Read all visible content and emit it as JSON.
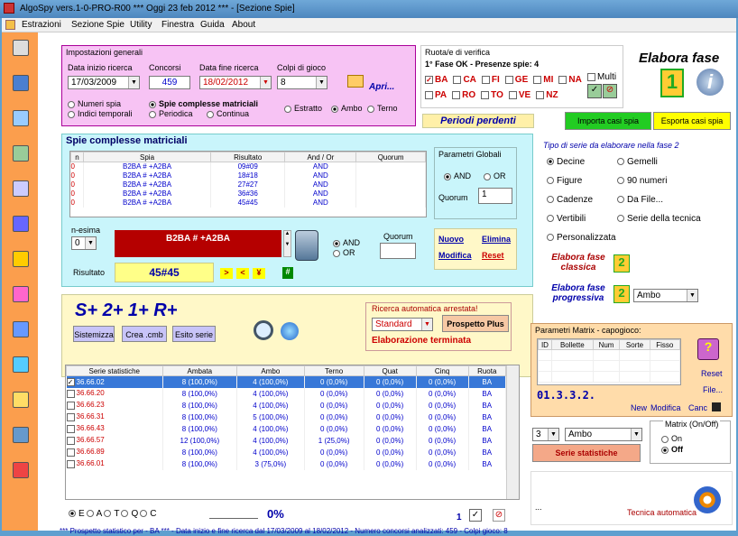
{
  "window": {
    "title": "AlgoSpy vers.1-0-PRO-R00  ***  Oggi 23 feb 2012  ***  - [Sezione Spie]"
  },
  "menu": [
    "Estrazioni",
    "Sezione Spie",
    "Utility",
    "Finestra",
    "Guida",
    "About"
  ],
  "general": {
    "title": "Impostazioni generali",
    "start_label": "Data inizio ricerca",
    "start": "17/03/2009",
    "concorsi_label": "Concorsi",
    "concorsi": "459",
    "end_label": "Data fine ricerca",
    "end": "18/02/2012",
    "colpi_label": "Colpi di gioco",
    "colpi": "8",
    "apri": "Apri...",
    "numeri_spia": "Numeri spia",
    "indici_temporali": "Indici temporali",
    "spie_complesse": "Spie complesse matriciali",
    "periodica": "Periodica",
    "continua": "Continua",
    "estratto": "Estratto",
    "ambo": "Ambo",
    "terno": "Terno"
  },
  "ruota": {
    "title": "Ruota/e di verifica",
    "status": "1° Fase OK - Presenze spie: 4",
    "row1": [
      "BA",
      "CA",
      "FI",
      "GE",
      "MI",
      "NA"
    ],
    "row2": [
      "PA",
      "RO",
      "TO",
      "VE",
      "NZ"
    ],
    "multi": "Multi"
  },
  "elabora": {
    "title": "Elabora fase",
    "digit": "1"
  },
  "periodi": "Periodi perdenti",
  "importa": "Importa casi spia",
  "esporta": "Esporta casi spia",
  "spie": {
    "title": "Spie complesse matriciali",
    "cols": [
      "n",
      "Spia",
      "Risultato",
      "And / Or",
      "Quorum"
    ],
    "rows": [
      [
        "0",
        "B2BA # +A2BA",
        "09#09",
        "AND",
        ""
      ],
      [
        "0",
        "B2BA # +A2BA",
        "18#18",
        "AND",
        ""
      ],
      [
        "0",
        "B2BA # +A2BA",
        "27#27",
        "AND",
        ""
      ],
      [
        "0",
        "B2BA # +A2BA",
        "36#36",
        "AND",
        ""
      ],
      [
        "0",
        "B2BA # +A2BA",
        "45#45",
        "AND",
        ""
      ]
    ],
    "nesima_label": "n-esima",
    "nesima": "0",
    "formula": "B2BA # +A2BA",
    "risultato_label": "Risultato",
    "risultato": "45#45",
    "and": "AND",
    "or": "OR",
    "quorum_label": "Quorum",
    "nuovo": "Nuovo",
    "elimina": "Elimina",
    "modifica": "Modifica",
    "reset": "Reset",
    "nav": [
      ">",
      "<",
      "¥"
    ],
    "hash": "#"
  },
  "globali": {
    "title": "Parametri Globali",
    "and": "AND",
    "or": "OR",
    "quorum_label": "Quorum",
    "quorum": "1"
  },
  "tipo": {
    "title": "Tipo di serie da elaborare nella fase 2",
    "left": [
      "Decine",
      "Figure",
      "Cadenze",
      "Vertibili",
      "Personalizzata"
    ],
    "right": [
      "Gemelli",
      "90 numeri",
      "Da File...",
      "Serie della tecnica"
    ],
    "classica": "Elabora fase classica",
    "progressiva": "Elabora fase progressiva",
    "ambo": "Ambo",
    "d2": "2"
  },
  "sistemi": {
    "title": "S+ 2+ 1+ R+",
    "sistemizza": "Sistemizza",
    "crea": "Crea .cmb",
    "esito": "Esito serie",
    "ricerca_title": "Ricerca automatica arrestata!",
    "standard": "Standard",
    "prospetto": "Prospetto Plus",
    "status": "Elaborazione terminata"
  },
  "serie": {
    "cols": [
      "Serie statistiche",
      "Ambata",
      "Ambo",
      "Terno",
      "Quat",
      "Cinq",
      "Ruota"
    ],
    "rows": [
      [
        "36.66.02",
        "8 (100,0%)",
        "4 (100,0%)",
        "0 (0,0%)",
        "0 (0,0%)",
        "0 (0,0%)",
        "BA"
      ],
      [
        "36.66.20",
        "8 (100,0%)",
        "4 (100,0%)",
        "0 (0,0%)",
        "0 (0,0%)",
        "0 (0,0%)",
        "BA"
      ],
      [
        "36.66.23",
        "8 (100,0%)",
        "4 (100,0%)",
        "0 (0,0%)",
        "0 (0,0%)",
        "0 (0,0%)",
        "BA"
      ],
      [
        "36.66.31",
        "8 (100,0%)",
        "5 (100,0%)",
        "0 (0,0%)",
        "0 (0,0%)",
        "0 (0,0%)",
        "BA"
      ],
      [
        "36.66.43",
        "8 (100,0%)",
        "4 (100,0%)",
        "0 (0,0%)",
        "0 (0,0%)",
        "0 (0,0%)",
        "BA"
      ],
      [
        "36.66.57",
        "12 (100,0%)",
        "4 (100,0%)",
        "1 (25,0%)",
        "0 (0,0%)",
        "0 (0,0%)",
        "BA"
      ],
      [
        "36.66.89",
        "8 (100,0%)",
        "4 (100,0%)",
        "0 (0,0%)",
        "0 (0,0%)",
        "0 (0,0%)",
        "BA"
      ],
      [
        "36.66.01",
        "8 (100,0%)",
        "3 (75,0%)",
        "0 (0,0%)",
        "0 (0,0%)",
        "0 (0,0%)",
        "BA"
      ]
    ]
  },
  "filters": [
    "E",
    "A",
    "T",
    "Q",
    "C"
  ],
  "percent": "0%",
  "page_num": "1",
  "status": "*** Prospetto statistico per  - BA ***  - Data inizio e fine ricerca dal 17/03/2009 al 18/02/2012 - Numero concorsi analizzati: 459 - Colpi gioco: 8",
  "matrix": {
    "title": "Parametri Matrix - capogioco:",
    "cols": [
      "ID",
      "Bollette",
      "Num",
      "Sorte",
      "Fisso"
    ],
    "code": "01.3.3.2.",
    "new": "New",
    "modifica": "Modifica",
    "canc": "Canc",
    "reset": "Reset",
    "file": "File..."
  },
  "matrix_onoff": {
    "title": "Matrix (On/Off)",
    "on": "On",
    "off": "Off",
    "n": "3",
    "ambo": "Ambo",
    "serie": "Serie statistiche"
  },
  "tecnica": "Tecnica automatica",
  "ellipsis": "...",
  "colors": {
    "orange": "#fb9e4d",
    "pink": "#f7c3f4",
    "cyan": "#c9f5fb",
    "green": "#22cc22",
    "yellow": "#ffff00"
  }
}
